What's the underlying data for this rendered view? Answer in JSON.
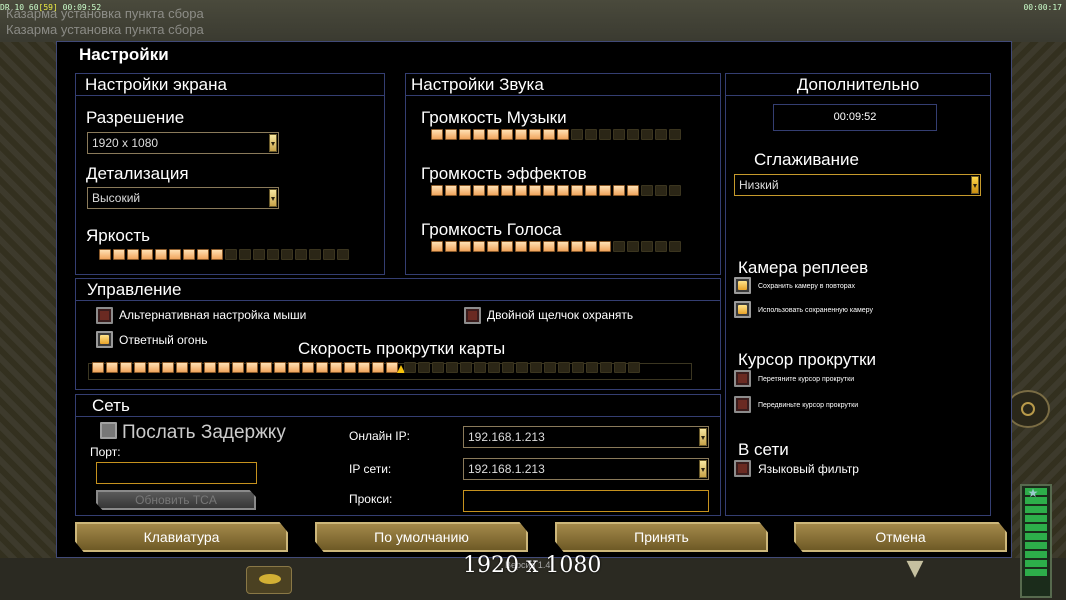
{
  "hud": {
    "top_left": "DR 10 60",
    "top_left_bracket": "[59]",
    "top_left_time": "00:09:52",
    "top_right_time": "00:00:17",
    "ghost_line1": "Казарма установка пункта сбора",
    "ghost_line2": "Казарма установка пункта сбора"
  },
  "dialog": {
    "title": "Настройки"
  },
  "screen": {
    "title": "Настройки экрана",
    "resolution_label": "Разрешение",
    "resolution_value": "1920 x 1080",
    "detail_label": "Детализация",
    "detail_value": "Высокий",
    "brightness_label": "Яркость",
    "brightness_level": 9,
    "brightness_total": 18
  },
  "sound": {
    "title": "Настройки Звука",
    "music_label": "Громкость Музыки",
    "music_level": 10,
    "music_total": 18,
    "effects_label": "Громкость эффектов",
    "effects_level": 15,
    "effects_total": 18,
    "voice_label": "Громкость Голоса",
    "voice_level": 13,
    "voice_total": 18
  },
  "extra": {
    "title": "Дополнительно",
    "clock": "00:09:52",
    "antialias_label": "Сглаживание",
    "antialias_value": "Низкий",
    "replay_camera_label": "Камера реплеев",
    "replay_opt1": "Сохранить камеру в повторах",
    "replay_opt2": "Использовать сохраненную камеру",
    "scroll_cursor_label": "Курсор прокрутки",
    "scroll_opt1": "Перетяните курсор прокрутки",
    "scroll_opt2": "Передвиньте курсор прокрутки",
    "online_label": "В сети",
    "lang_filter_label": "Языковый фильтр"
  },
  "controls": {
    "title": "Управление",
    "alt_mouse_label": "Альтернативная настройка мыши",
    "double_click_label": "Двойной щелчок охранять",
    "return_fire_label": "Ответный огонь",
    "scroll_speed_label": "Скорость прокрутки карты",
    "scroll_speed_level": 22,
    "scroll_speed_total": 39
  },
  "network": {
    "title": "Сеть",
    "send_delay_label": "Послать Задержку",
    "port_label": "Порт:",
    "update_tca_label": "Обновить TCA",
    "online_ip_label": "Онлайн IP:",
    "online_ip_value": "192.168.1.213",
    "lan_ip_label": "IP сети:",
    "lan_ip_value": "192.168.1.213",
    "proxy_label": "Прокси:"
  },
  "buttons": {
    "keyboard": "Клавиатура",
    "defaults": "По умолчанию",
    "accept": "Принять",
    "cancel": "Отмена"
  },
  "overlay": {
    "resolution_text": "1920 x 1080",
    "version_text": "Версия 1.4"
  }
}
